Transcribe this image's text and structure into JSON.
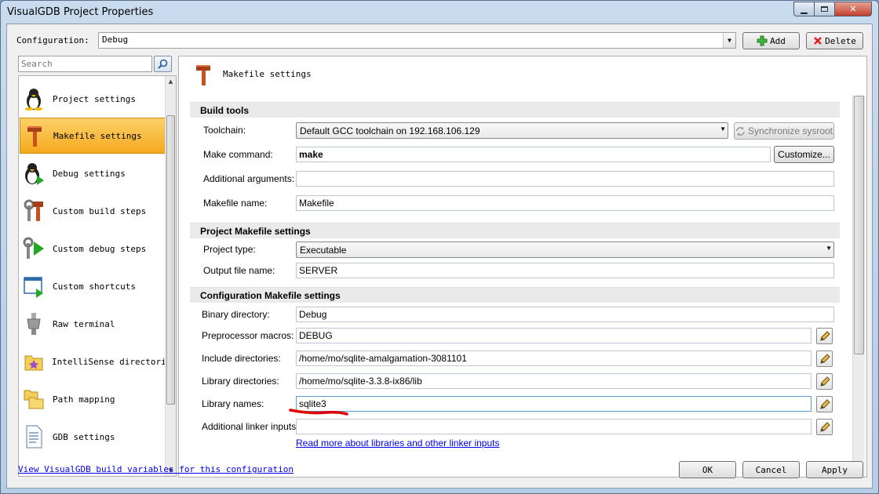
{
  "window": {
    "title": "VisualGDB Project Properties"
  },
  "configuration": {
    "label": "Configuration:",
    "value": "Debug",
    "add_label": "Add",
    "delete_label": "Delete"
  },
  "search": {
    "placeholder": "Search"
  },
  "sidebar": {
    "items": [
      {
        "label": "Project settings",
        "icon": "linux-penguin-icon"
      },
      {
        "label": "Makefile settings",
        "icon": "hammer-icon"
      },
      {
        "label": "Debug settings",
        "icon": "linux-penguin-play-icon"
      },
      {
        "label": "Custom build steps",
        "icon": "tools-icon"
      },
      {
        "label": "Custom debug steps",
        "icon": "tools-play-icon"
      },
      {
        "label": "Custom shortcuts",
        "icon": "window-shortcut-icon"
      },
      {
        "label": "Raw terminal",
        "icon": "serial-connector-icon"
      },
      {
        "label": "IntelliSense directories",
        "icon": "folder-star-icon"
      },
      {
        "label": "Path mapping",
        "icon": "folders-icon"
      },
      {
        "label": "GDB settings",
        "icon": "document-icon"
      }
    ],
    "selected_index": 1
  },
  "page": {
    "title": "Makefile settings"
  },
  "sections": {
    "build_tools": {
      "header": "Build tools",
      "toolchain_label": "Toolchain:",
      "toolchain_value": "Default GCC toolchain on 192.168.106.129",
      "sync_label": "Synchronize sysroot",
      "make_label": "Make command:",
      "make_value": "make",
      "customize_label": "Customize...",
      "args_label": "Additional arguments:",
      "args_value": "",
      "makefile_label": "Makefile name:",
      "makefile_value": "Makefile"
    },
    "project_makefile": {
      "header": "Project Makefile settings",
      "type_label": "Project type:",
      "type_value": "Executable",
      "output_label": "Output file name:",
      "output_value": "SERVER"
    },
    "config_makefile": {
      "header": "Configuration Makefile settings",
      "bin_label": "Binary directory:",
      "bin_value": "Debug",
      "macros_label": "Preprocessor macros:",
      "macros_value": "DEBUG",
      "include_label": "Include directories:",
      "include_value": "/home/mo/sqlite-amalgamation-3081101",
      "libdir_label": "Library directories:",
      "libdir_value": "/home/mo/sqlite-3.3.8-ix86/lib",
      "libnames_label": "Library names:",
      "libnames_value": "sqlite3",
      "linker_label": "Additional linker inputs:",
      "linker_value": "",
      "read_more": "Read more about libraries and other linker inputs"
    }
  },
  "footer": {
    "vars_link": "View VisualGDB build variables for this configuration",
    "ok": "OK",
    "cancel": "Cancel",
    "apply": "Apply"
  },
  "colors": {
    "accent_selection": "#f6a91c",
    "link": "#0000ee",
    "annotation": "#e00000"
  }
}
